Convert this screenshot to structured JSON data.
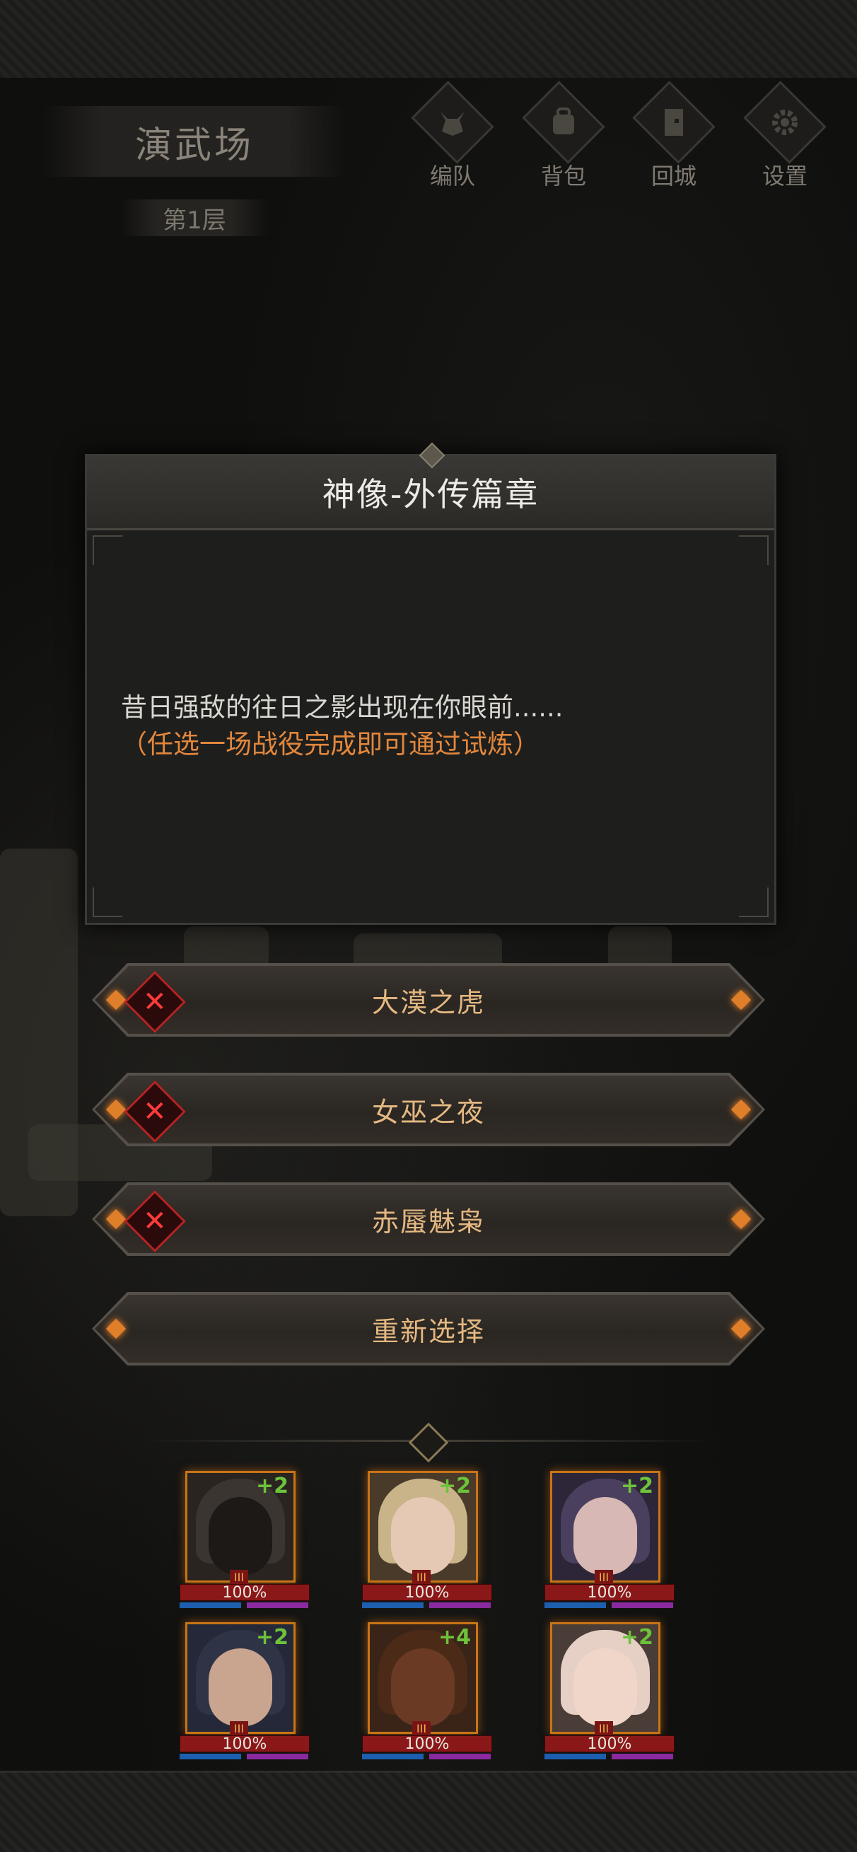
{
  "header": {
    "location": "演武场",
    "floor": "第1层",
    "nav": [
      {
        "label": "编队",
        "icon": "helmet-icon"
      },
      {
        "label": "背包",
        "icon": "backpack-icon"
      },
      {
        "label": "回城",
        "icon": "door-icon"
      },
      {
        "label": "设置",
        "icon": "gear-icon"
      }
    ]
  },
  "dialog": {
    "title": "神像-外传篇章",
    "text": "昔日强敌的往日之影出现在你眼前......",
    "hint": "（任选一场战役完成即可通过试炼）"
  },
  "choices": [
    {
      "label": "大漠之虎",
      "failed": true
    },
    {
      "label": "女巫之夜",
      "failed": true
    },
    {
      "label": "赤蜃魅枭",
      "failed": true
    },
    {
      "label": "重新选择",
      "failed": false
    }
  ],
  "heroes": [
    {
      "bonus": "+2",
      "hp": "100%",
      "rank": "III"
    },
    {
      "bonus": "+2",
      "hp": "100%",
      "rank": "III"
    },
    {
      "bonus": "+2",
      "hp": "100%",
      "rank": "III"
    },
    {
      "bonus": "+2",
      "hp": "100%",
      "rank": "III"
    },
    {
      "bonus": "+4",
      "hp": "100%",
      "rank": "III"
    },
    {
      "bonus": "+2",
      "hp": "100%",
      "rank": "III"
    }
  ],
  "colors": {
    "accent_orange": "#e2873c",
    "choice_text": "#e4b882",
    "fail_red": "#ff3b3b",
    "hp_red": "#8b1818",
    "bonus_green": "#6dc23b"
  }
}
